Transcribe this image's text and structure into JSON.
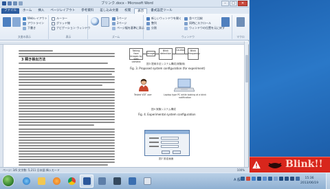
{
  "window": {
    "title": "ブリンク.docx - Microsoft Word",
    "caps": {
      "minimize": "–",
      "maximize": "□",
      "close": "✕"
    }
  },
  "ribbon": {
    "tabs": [
      "ファイル",
      "ホーム",
      "挿入",
      "ページレイアウト",
      "参考資料",
      "差し込み文書",
      "校閲",
      "表示",
      "書式設定ツール"
    ],
    "active_tab_index": 7,
    "groups": [
      {
        "label": "文書の表示",
        "items": [
          "印刷レイアウト",
          "全画面閲覧",
          "Webレイアウト",
          "アウトライン",
          "下書き"
        ]
      },
      {
        "label": "表示",
        "items": [
          "ルーラー",
          "グリッド線",
          "ナビゲーション ウィンドウ"
        ]
      },
      {
        "label": "ズーム",
        "items": [
          "ズーム",
          "100%",
          "1ページ",
          "2ページ",
          "ページ幅を基準に表示"
        ]
      },
      {
        "label": "ウィンドウ",
        "items": [
          "新しいウィンドウを開く",
          "整列",
          "分割",
          "並べて比較",
          "同時にスクロール",
          "ウィンドウの位置を元に戻す",
          "ウィンドウの切り替え"
        ]
      },
      {
        "label": "マクロ",
        "items": [
          "マクロ"
        ]
      }
    ]
  },
  "document": {
    "section_heading": "3 瞬き検出方法",
    "figures": [
      {
        "caption_en": "Fig. 3.    Proposed system configuration (for experiment)",
        "caption_jp": "図3  提案手法システム構成(実験用)"
      },
      {
        "caption_en": "Fig. 4.    Experimental system configuration",
        "caption_jp": "図4  実験システム構成"
      },
      {
        "caption_en": "",
        "caption_jp": "図7  設定画面"
      }
    ],
    "flow_boxes": [
      "Taking face images by web camera",
      "Image",
      "Blink detection",
      "Caution",
      "Blink frequency"
    ],
    "user_label": "Tested VDT user",
    "laptop_label": "Laptop type PC while looking at a blink notification"
  },
  "statusbar": {
    "text": "ページ: 3/6   文字数: 5,211   日本語   挿入モード",
    "zoom": "100%"
  },
  "popup": {
    "text": "Blink!!",
    "bg_color": "#d8261c"
  },
  "taskbar": {
    "apps": [
      "ie-icon",
      "explorer-icon",
      "media-player-icon",
      "chrome-icon",
      "word-icon",
      "paint-icon",
      "settings-icon",
      "app-icon",
      "blink-icon"
    ],
    "active_app": "word-icon",
    "lang": "A 般",
    "clock_time": "15:36",
    "clock_date": "2013/06/19"
  }
}
